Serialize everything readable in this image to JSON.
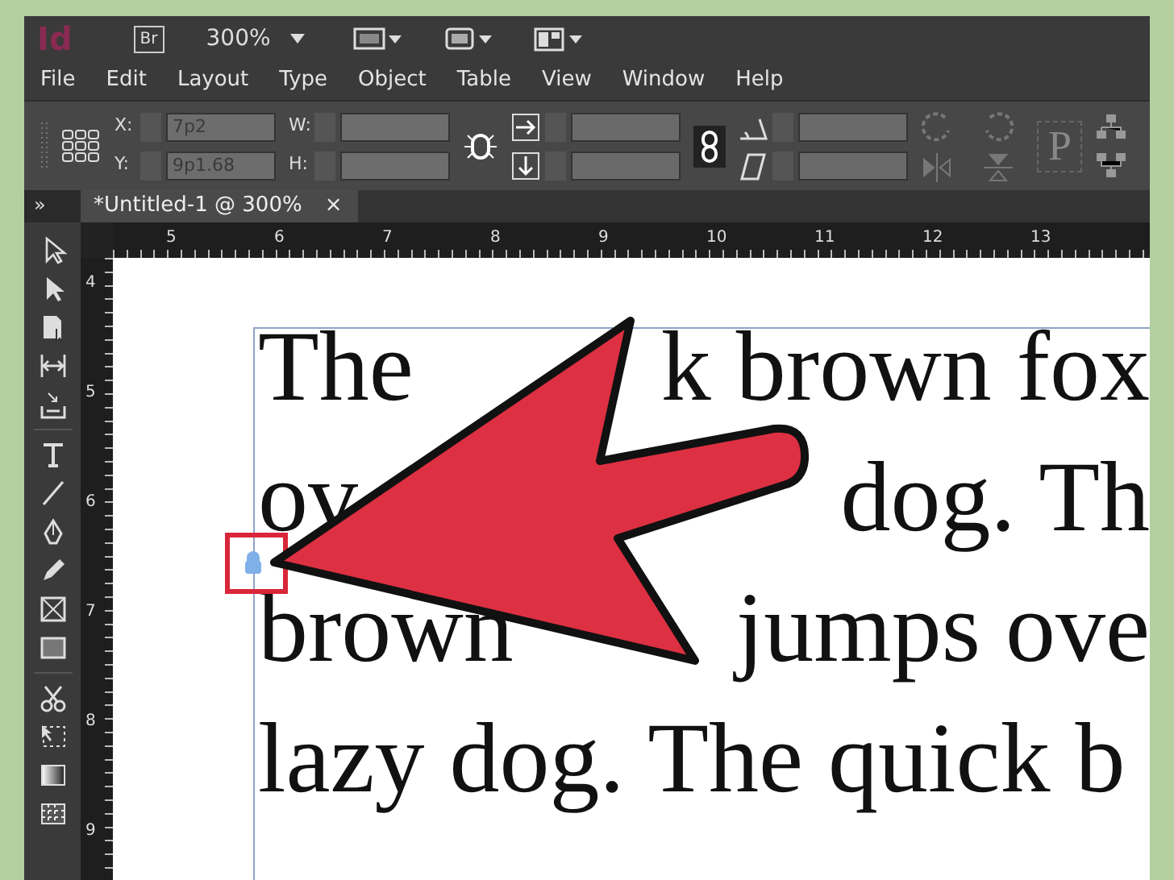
{
  "app_bar": {
    "logo": "Id",
    "bridge": "Br",
    "zoom": "300%"
  },
  "menu": [
    "File",
    "Edit",
    "Layout",
    "Type",
    "Object",
    "Table",
    "View",
    "Window",
    "Help"
  ],
  "control_panel": {
    "x_label": "X:",
    "x_value": "7p2",
    "y_label": "Y:",
    "y_value": "9p1.68",
    "w_label": "W:",
    "h_label": "H:",
    "proxy_glyph": "P"
  },
  "panel_toggle": "»",
  "document_tab": {
    "title": "*Untitled-1 @ 300%",
    "close": "×",
    "selected": true
  },
  "ruler": {
    "horizontal": [
      "5",
      "6",
      "7",
      "8",
      "9",
      "10",
      "11",
      "12",
      "13"
    ],
    "vertical": [
      "4",
      "5",
      "6",
      "7",
      "8",
      "9"
    ]
  },
  "text_frame": {
    "lines": [
      [
        "The",
        "k brown fox"
      ],
      [
        "ov",
        "dog. Th"
      ],
      [
        "brown",
        "jumps ove"
      ],
      [
        "lazy dog. The quick b"
      ]
    ]
  }
}
